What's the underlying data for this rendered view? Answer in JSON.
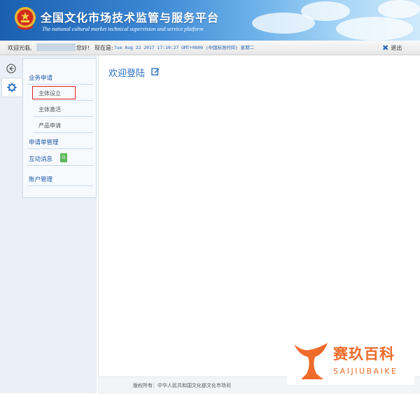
{
  "header": {
    "title": "全国文化市场技术监管与服务平台",
    "subtitle": "The national cultural market technical supervision and service platform",
    "emblem_icon": "national-emblem-icon",
    "brand_color": "#2a6fbe"
  },
  "statusbar": {
    "welcome": "欢迎光临,",
    "greeting": "您好!",
    "now_label": "现在是:",
    "datetime": "Tue Aug 22 2017 17:10:27 GMT+0800 (中国标准时间) 星期二",
    "logout_label": "退出",
    "logout_icon": "close-x-icon"
  },
  "iconbar": {
    "collapse_icon": "circle-arrow-left-icon",
    "settings_icon": "gear-icon"
  },
  "sidebar": {
    "section_business": "业务申请",
    "sub_items": [
      "主体设立",
      "主体激活",
      "产品申请"
    ],
    "application_management": "申请单管理",
    "messages": "互动消息",
    "messages_count": "0",
    "account_management": "账户管理"
  },
  "main": {
    "title": "欢迎登陆",
    "edit_icon": "edit-icon"
  },
  "footer": {
    "copyright": "版权所有：中华人民共和国文化部文化市场司"
  },
  "watermark": {
    "name": "赛玖百科",
    "latin": "SAIJIUBAIKE",
    "color": "#ee6b2a"
  }
}
